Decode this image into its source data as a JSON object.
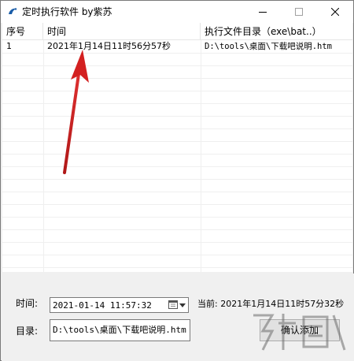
{
  "window": {
    "title": "定时执行软件 by紫苏"
  },
  "list": {
    "columns": [
      "序号",
      "时间",
      "执行文件目录（exe\\bat..）"
    ],
    "rows": [
      {
        "index": "1",
        "time": "2021年1月14日11时56分57秒",
        "path": "D:\\tools\\桌面\\下载吧说明.htm"
      }
    ]
  },
  "form": {
    "time_label": "时间:",
    "time_value": "2021-01-14 11:57:32",
    "current_label": "当前: 2021年1月14日11时57分32秒",
    "dir_label": "目录:",
    "dir_value": "D:\\tools\\桌面\\下载吧说明.htm",
    "add_button": "确认添加"
  },
  "colors": {
    "window_bg": "#f0f0f0",
    "arrow": "#d32020",
    "button_bg": "#e1e1e1"
  },
  "icons": {
    "app": "app-icon",
    "minimize": "minimize-icon",
    "maximize": "maximize-icon",
    "close": "close-icon",
    "calendar": "calendar-icon",
    "dropdown": "chevron-down-icon"
  }
}
